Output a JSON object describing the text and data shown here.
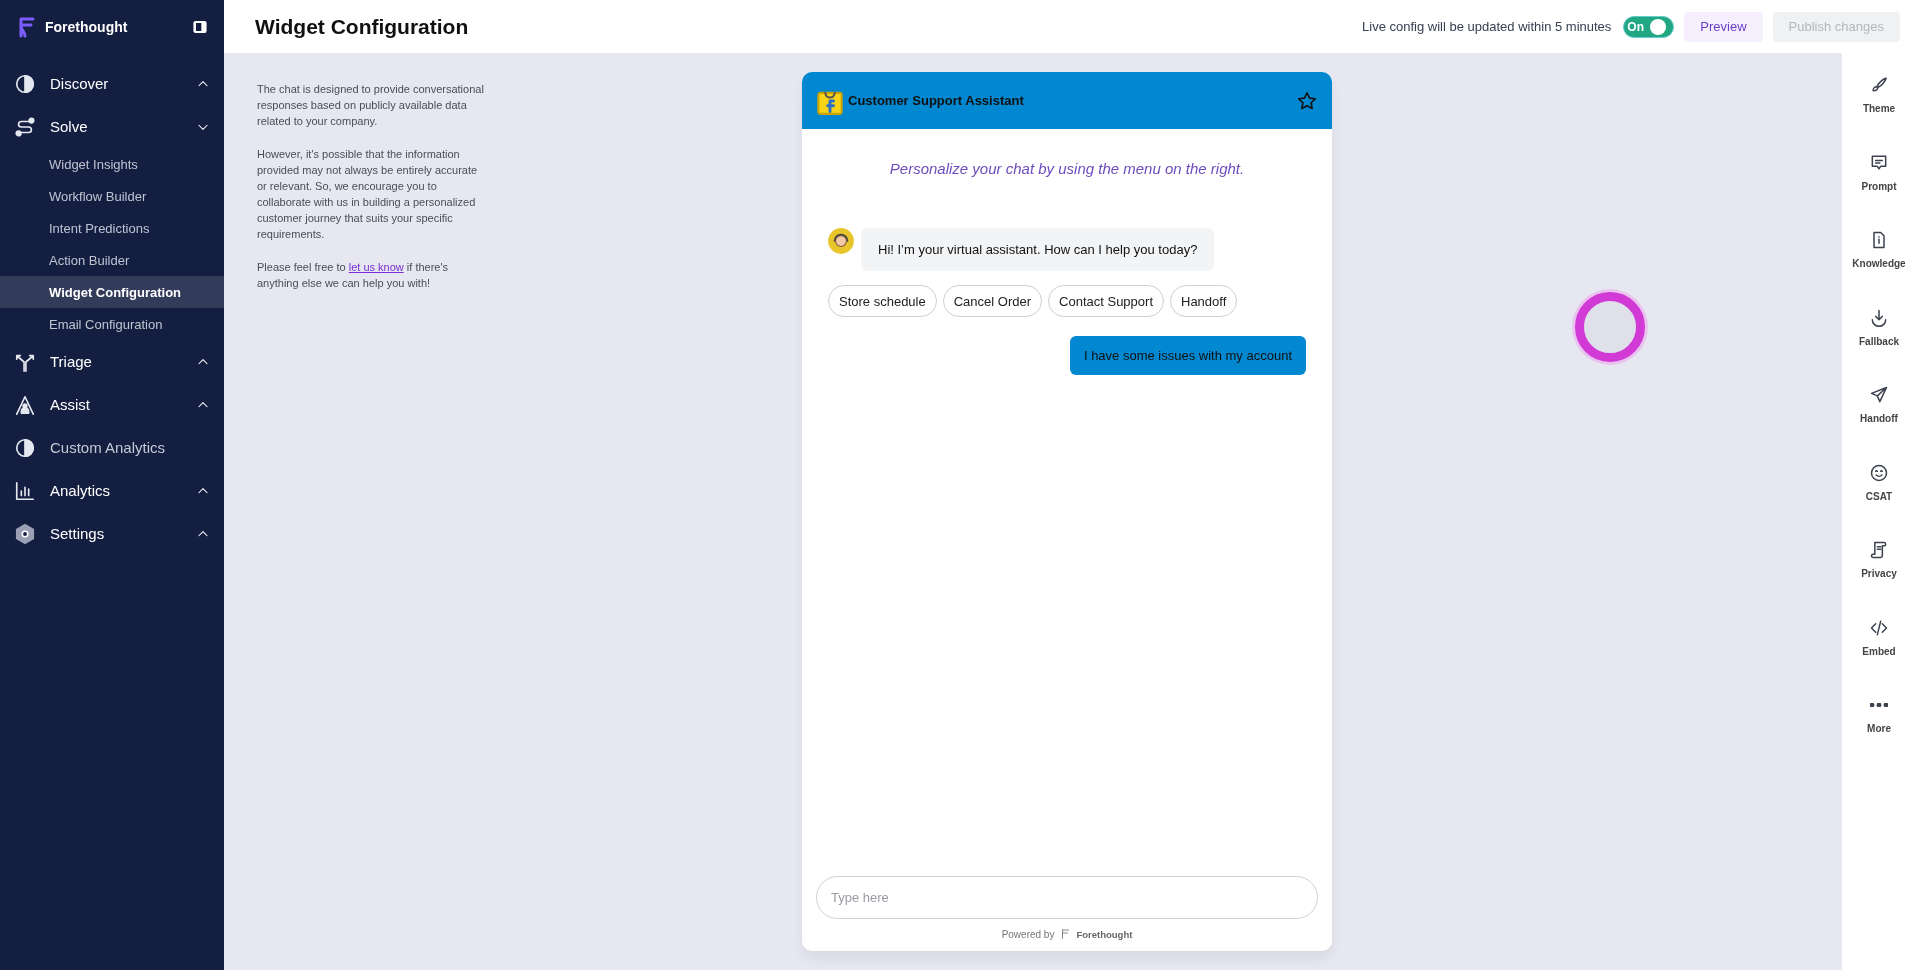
{
  "sidebar": {
    "brand": "Forethought",
    "items": [
      {
        "kind": "section",
        "label": "Discover",
        "expanded": false
      },
      {
        "kind": "section",
        "label": "Solve",
        "expanded": true,
        "children": [
          {
            "label": "Widget Insights",
            "selected": false
          },
          {
            "label": "Workflow Builder",
            "selected": false
          },
          {
            "label": "Intent Predictions",
            "selected": false
          },
          {
            "label": "Action Builder",
            "selected": false
          },
          {
            "label": "Widget Configuration",
            "selected": true
          },
          {
            "label": "Email Configuration",
            "selected": false
          }
        ]
      },
      {
        "kind": "section",
        "label": "Triage",
        "expanded": false
      },
      {
        "kind": "section",
        "label": "Assist",
        "expanded": false
      },
      {
        "kind": "link",
        "label": "Custom Analytics"
      },
      {
        "kind": "section",
        "label": "Analytics",
        "expanded": false
      },
      {
        "kind": "section",
        "label": "Settings",
        "expanded": false
      }
    ]
  },
  "header": {
    "title": "Widget Configuration",
    "note": "Live config will be updated within 5 minutes",
    "toggle": {
      "label": "On",
      "on": true
    },
    "preview": "Preview",
    "publish": {
      "label": "Publish changes",
      "disabled": true
    }
  },
  "info": {
    "paragraphs": [
      "The chat is designed to provide conversational responses based on publicly available data related to your company.",
      "However, it's possible that the information provided may not always be entirely accurate or relevant. So, we encourage you to collaborate with us in building a personalized customer journey that suits your specific requirements."
    ],
    "closing": {
      "before": "Please feel free to ",
      "link": "let us know",
      "after": " if there's anything else we can help you with!"
    }
  },
  "chat": {
    "title": "Customer Support Assistant",
    "hint": "Personalize your chat by using the menu on the right.",
    "messages": [
      {
        "kind": "bot",
        "text": "Hi! I’m your virtual assistant. How can I help you today?"
      },
      {
        "kind": "options",
        "options": [
          "Store schedule",
          "Cancel Order",
          "Contact Support",
          "Handoff"
        ]
      },
      {
        "kind": "user",
        "text": "I have some issues with my account"
      }
    ],
    "input": {
      "placeholder": "Type here"
    },
    "powered_by": "Powered by",
    "powered_brand": "Forethought"
  },
  "rail": [
    {
      "label": "Theme"
    },
    {
      "label": "Prompt"
    },
    {
      "label": "Knowledge"
    },
    {
      "label": "Fallback"
    },
    {
      "label": "Handoff"
    },
    {
      "label": "CSAT"
    },
    {
      "label": "Privacy"
    },
    {
      "label": "Embed"
    },
    {
      "label": "More"
    }
  ]
}
